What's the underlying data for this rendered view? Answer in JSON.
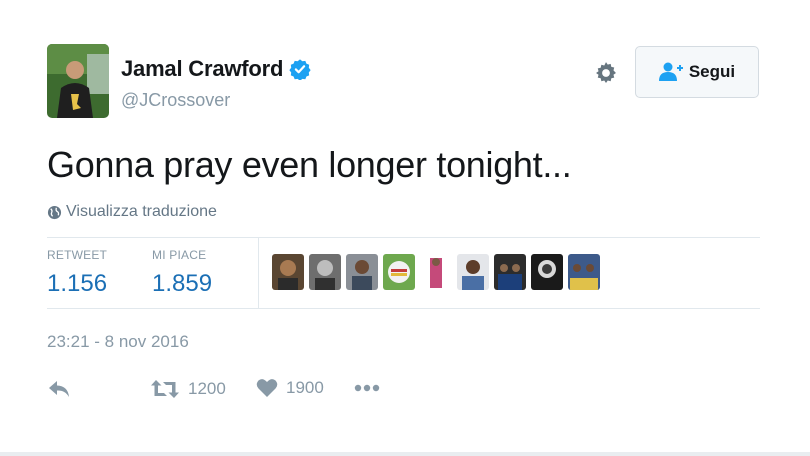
{
  "user": {
    "display_name": "Jamal Crawford",
    "handle": "@JCrossover"
  },
  "header": {
    "follow_label": "Segui"
  },
  "tweet": {
    "text": "Gonna pray even longer tonight...",
    "translate_label": "Visualizza traduzione",
    "timestamp": "23:21 - 8 nov 2016"
  },
  "stats": {
    "retweet_label": "RETWEET",
    "retweet_count": "1.156",
    "likes_label": "MI PIACE",
    "likes_count": "1.859"
  },
  "actions": {
    "retweet_count": "1200",
    "like_count": "1900"
  },
  "icons": [
    "verified-icon",
    "gear-icon",
    "follow-user-icon",
    "globe-icon",
    "reply-icon",
    "retweet-icon",
    "heart-icon",
    "more-icon"
  ],
  "colors": {
    "verified": "#1da1f2",
    "stat_value": "#1b6fb5",
    "muted": "#8899a6",
    "follow_icon": "#1da1f2"
  }
}
